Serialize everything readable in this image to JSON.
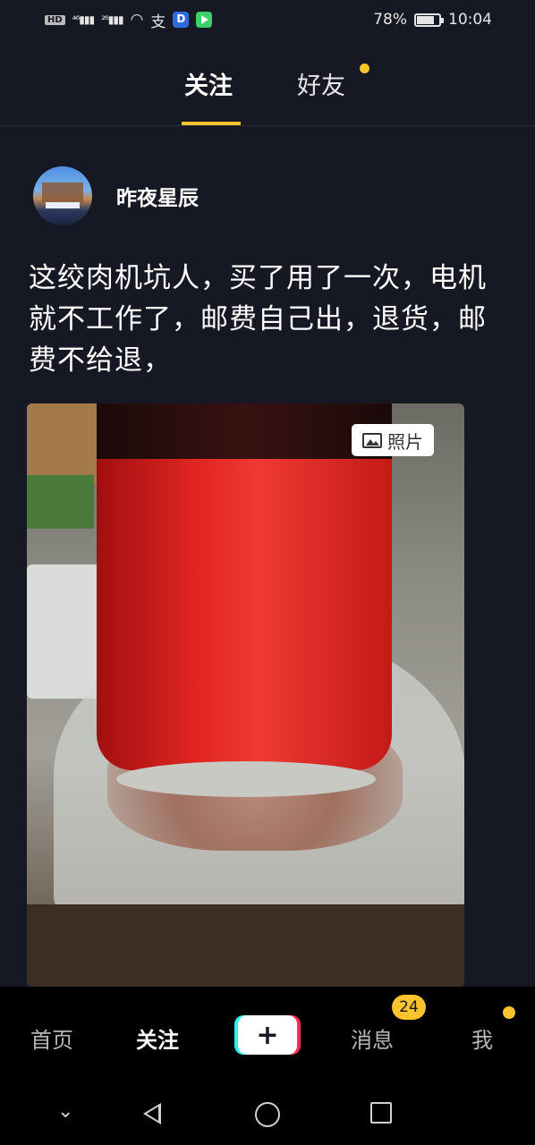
{
  "status_bar": {
    "left_icons": [
      "hd-icon",
      "signal-4g-icon",
      "signal-2g-icon",
      "wifi-icon",
      "alipay-icon",
      "app-d-icon",
      "play-icon"
    ],
    "battery": "78%",
    "time": "10:04"
  },
  "top_tabs": [
    {
      "label": "关注",
      "active": true
    },
    {
      "label": "好友",
      "active": false,
      "dot": true
    }
  ],
  "post": {
    "author": "昨夜星辰",
    "text": "这绞肉机坑人，买了用了一次，电机就不工作了，邮费自己出，退货，邮费不给退，",
    "media_badge": "照片"
  },
  "bottom_nav": {
    "items": [
      {
        "label": "首页",
        "active": false
      },
      {
        "label": "关注",
        "active": true
      },
      {
        "label": "+",
        "type": "create"
      },
      {
        "label": "消息",
        "active": false,
        "badge": "24"
      },
      {
        "label": "我",
        "active": false,
        "dot": true
      }
    ]
  },
  "colors": {
    "background": "#161823",
    "accent": "#fbc42e",
    "nav_bg": "#000000"
  }
}
